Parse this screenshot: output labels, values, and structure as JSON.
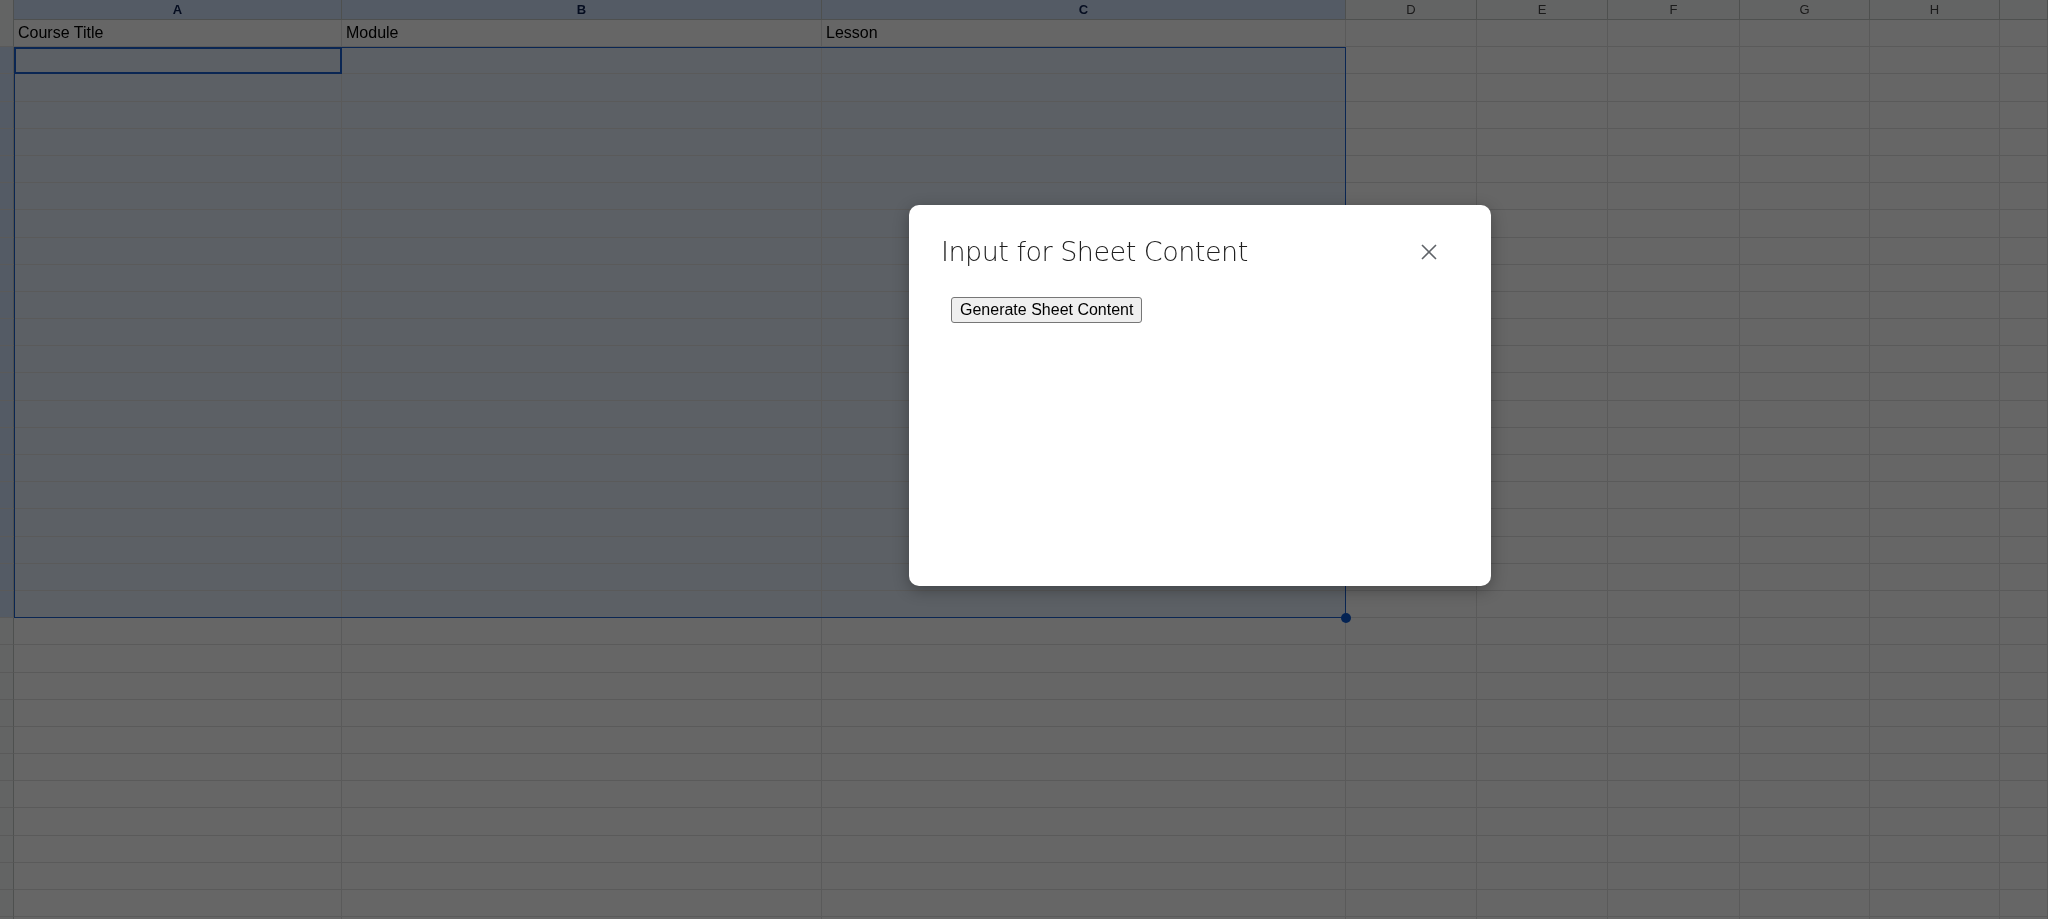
{
  "sheet": {
    "columns": [
      {
        "label": "A",
        "selected": true
      },
      {
        "label": "B",
        "selected": true
      },
      {
        "label": "C",
        "selected": true
      },
      {
        "label": "D",
        "selected": false
      },
      {
        "label": "E",
        "selected": false
      },
      {
        "label": "F",
        "selected": false
      },
      {
        "label": "G",
        "selected": false
      },
      {
        "label": "H",
        "selected": false
      }
    ],
    "header_row": [
      "Course Title",
      "Module",
      "Lesson"
    ]
  },
  "dialog": {
    "title": "Input for Sheet Content",
    "button": "Generate Sheet Content"
  }
}
